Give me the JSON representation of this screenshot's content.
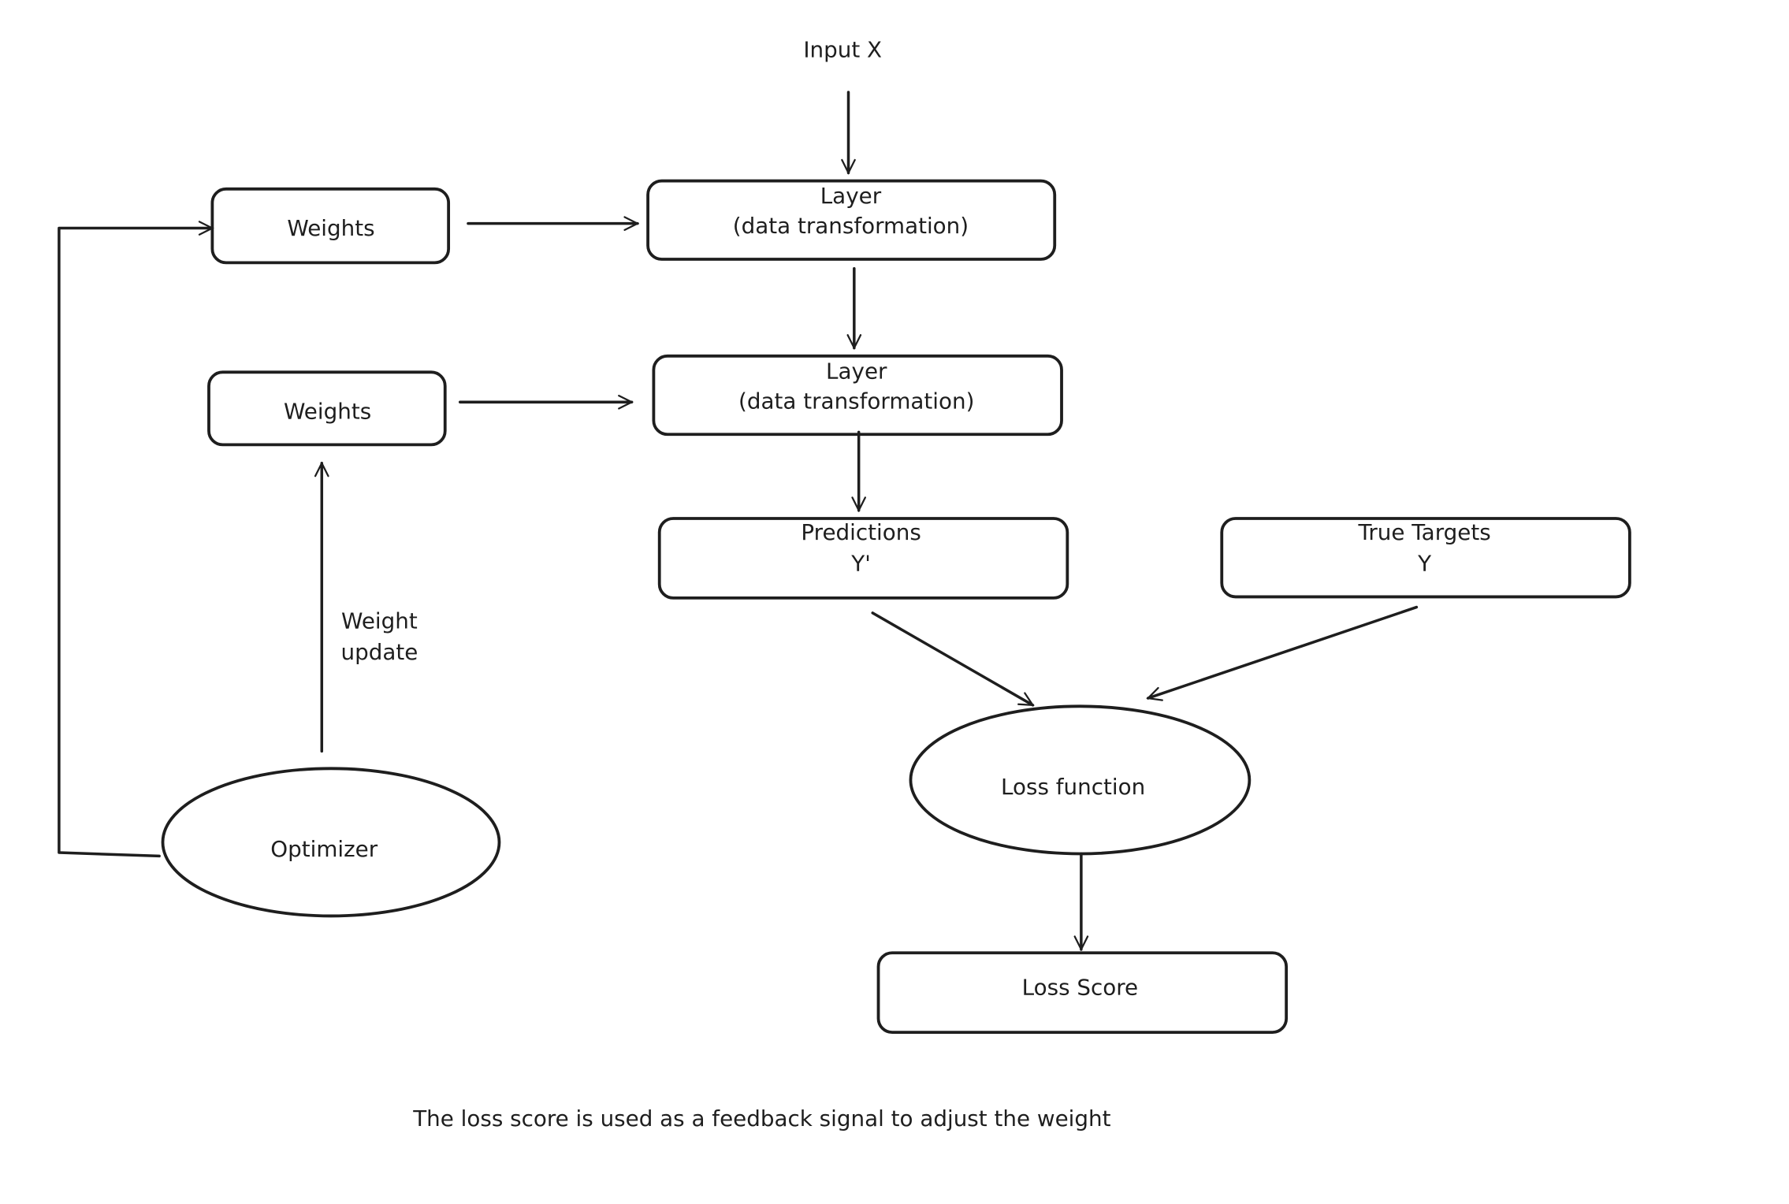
{
  "diagram": {
    "input_label": "Input X",
    "layer1": {
      "line1": "Layer",
      "line2": "(data transformation)"
    },
    "layer2": {
      "line1": "Layer",
      "line2": "(data transformation)"
    },
    "weights1": "Weights",
    "weights2": "Weights",
    "predictions": {
      "line1": "Predictions",
      "line2": "Y'"
    },
    "true_targets": {
      "line1": "True Targets",
      "line2": "Y"
    },
    "loss_function": "Loss function",
    "loss_score": "Loss Score",
    "optimizer": "Optimizer",
    "weight_update": {
      "line1": "Weight",
      "line2": "update"
    },
    "caption": "The loss score is used as a feedback signal to adjust the weight"
  },
  "colors": {
    "stroke": "#1e1e1e",
    "background": "#ffffff"
  }
}
